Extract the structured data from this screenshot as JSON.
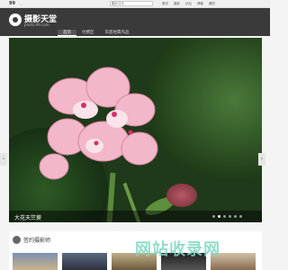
{
  "topbar": {
    "logo": "99",
    "tagline": "...",
    "search_category": "图片",
    "search_placeholder": "搜索",
    "nav": [
      "首页",
      "摄影",
      "论坛",
      "博客",
      "器材"
    ]
  },
  "brand": {
    "name": "摄影天堂",
    "domain": "photo.99.com"
  },
  "tabs": [
    {
      "label": "首页",
      "active": true
    },
    {
      "label": "付费区",
      "active": false
    },
    {
      "label": "年底经典作品",
      "active": false
    }
  ],
  "hero": {
    "caption": "大花天竺葵",
    "slide_count": 6,
    "active_slide": 1,
    "prev_glyph": "‹",
    "next_glyph": "›"
  },
  "section": {
    "title": "签约摄影师"
  },
  "watermark": "网站收录网",
  "colors": {
    "header_bg": "#3a3a3a",
    "accent": "#7fd6c2",
    "petal": "#e8a0b8"
  }
}
